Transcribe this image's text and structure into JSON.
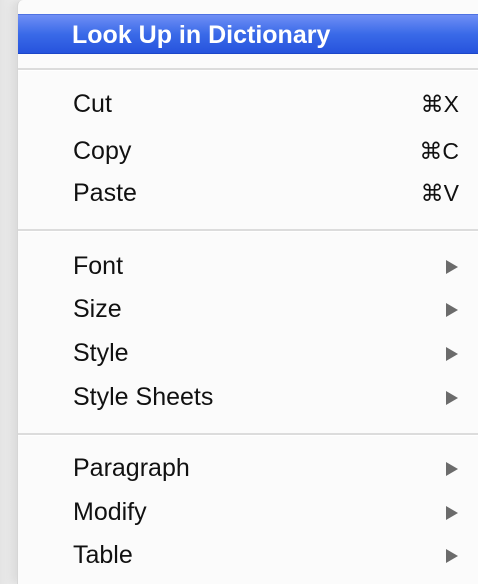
{
  "context_menu": {
    "items": [
      {
        "label": "Look Up in Dictionary"
      },
      {
        "label": "Cut",
        "shortcut": "⌘X"
      },
      {
        "label": "Copy",
        "shortcut": "⌘C"
      },
      {
        "label": "Paste",
        "shortcut": "⌘V"
      },
      {
        "label": "Font",
        "icon": "submenu-arrow-icon"
      },
      {
        "label": "Size",
        "icon": "submenu-arrow-icon"
      },
      {
        "label": "Style",
        "icon": "submenu-arrow-icon"
      },
      {
        "label": "Style Sheets",
        "icon": "submenu-arrow-icon"
      },
      {
        "label": "Paragraph",
        "icon": "submenu-arrow-icon"
      },
      {
        "label": "Modify",
        "icon": "submenu-arrow-icon"
      },
      {
        "label": "Table",
        "icon": "submenu-arrow-icon"
      }
    ],
    "highlight_color": "#3a6ae8",
    "submenu_arrow_color": "#6b6b6b"
  }
}
